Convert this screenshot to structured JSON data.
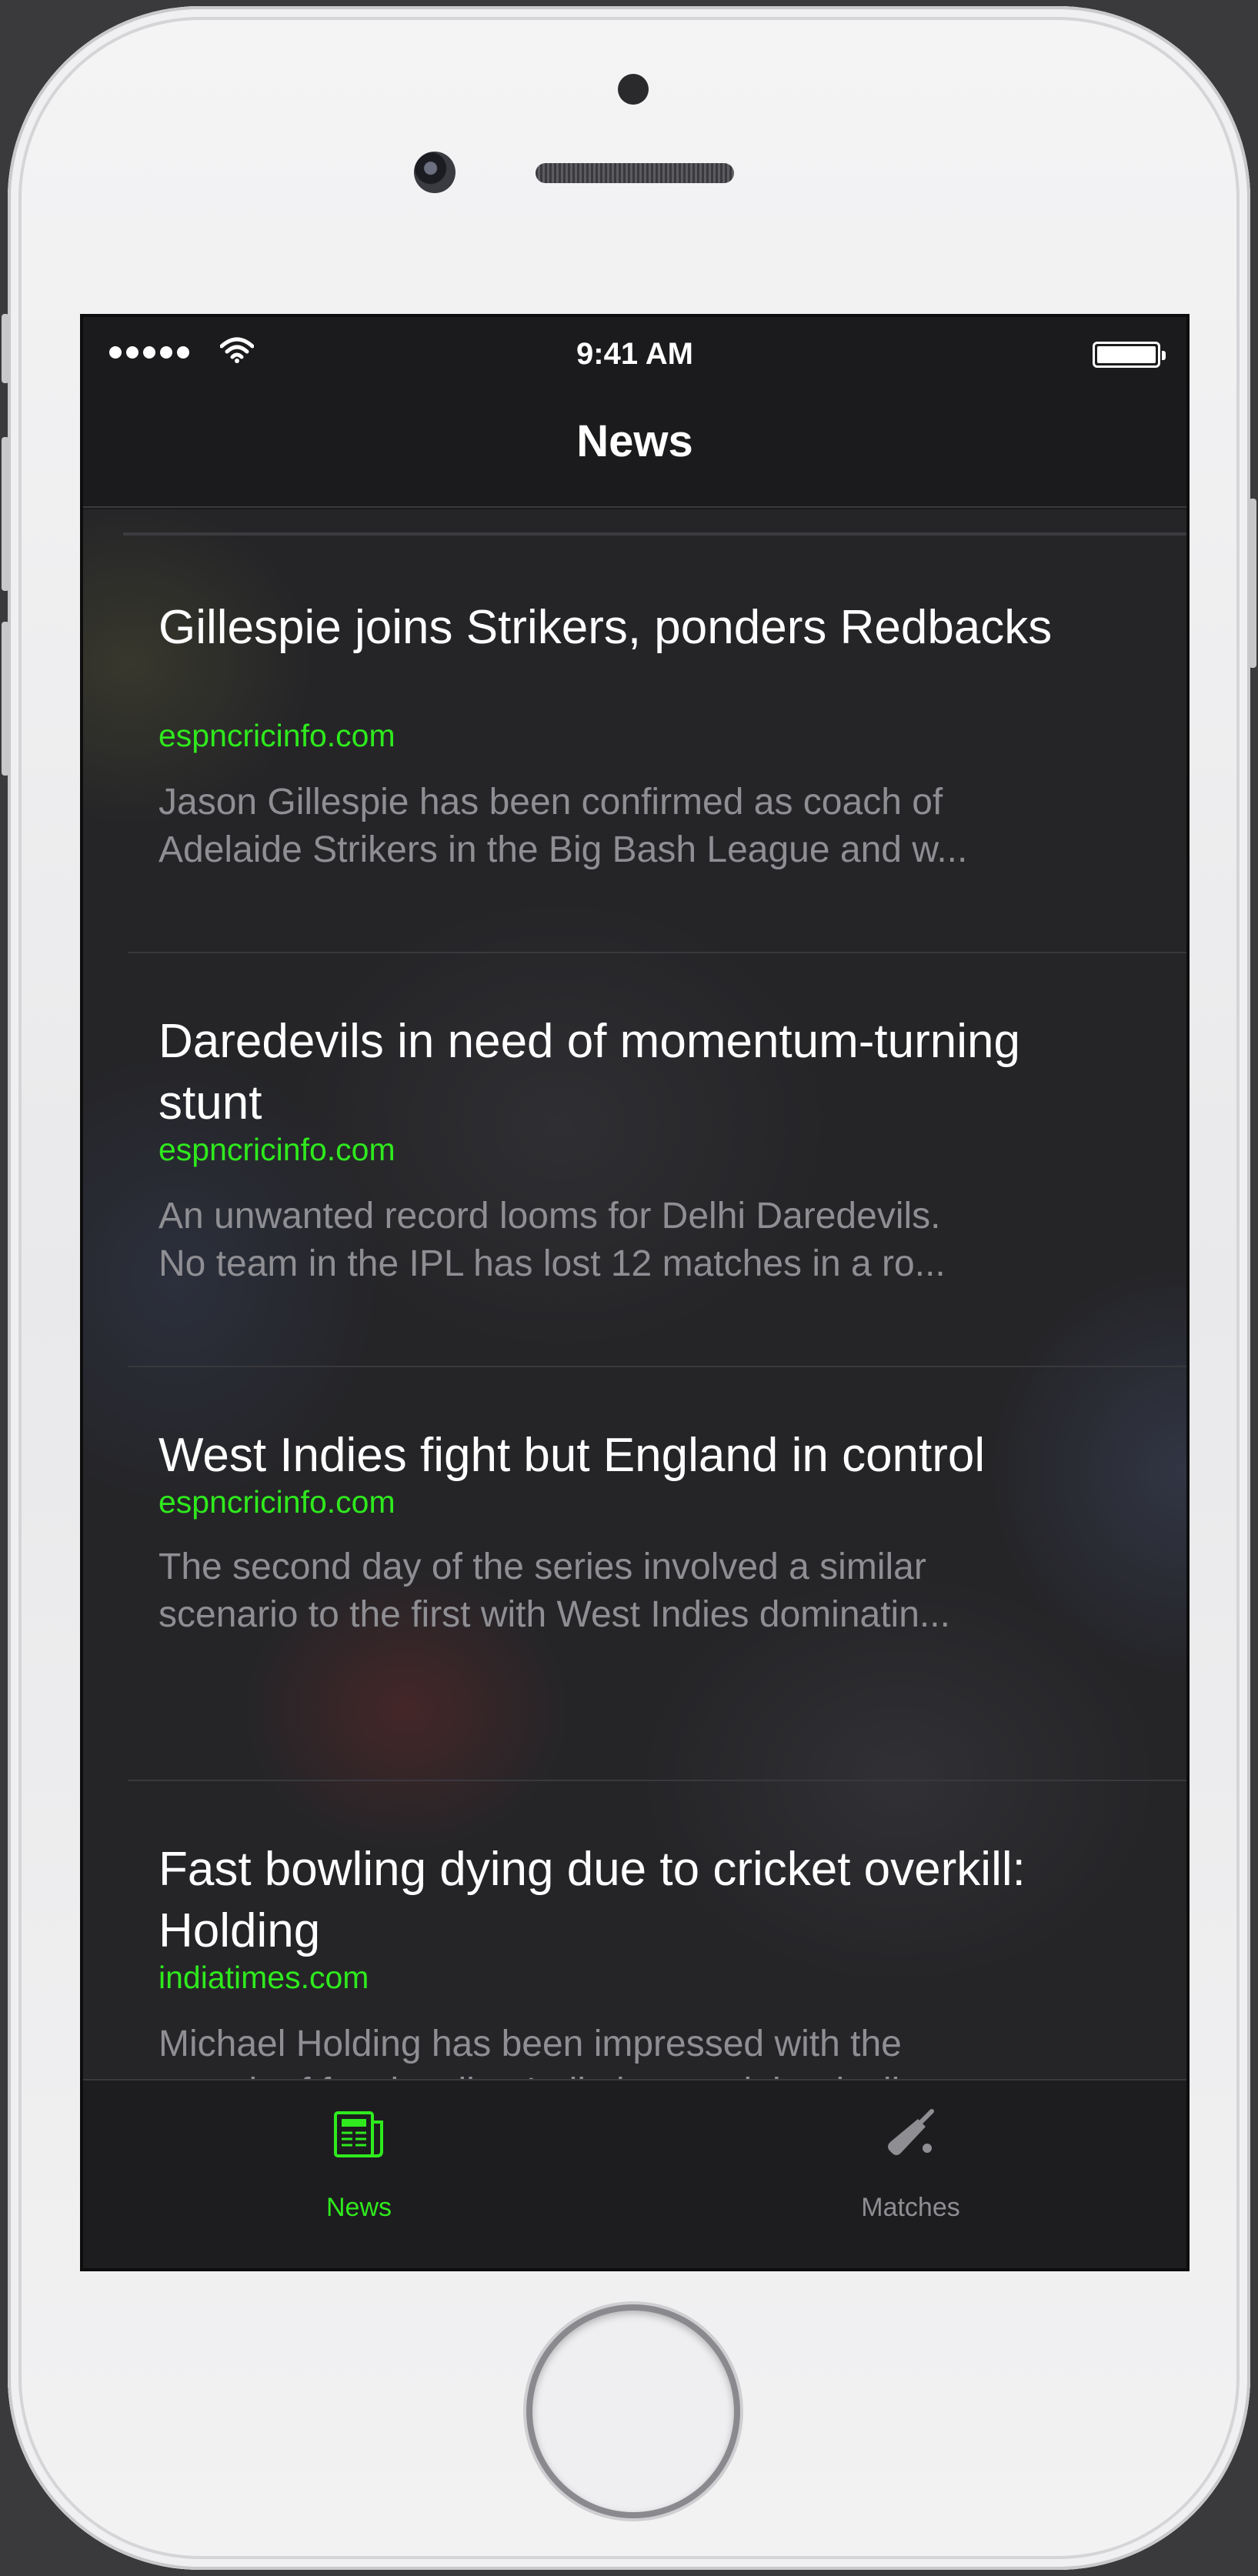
{
  "status_bar": {
    "time": "9:41 AM",
    "signal_icon": "signal-dots-icon",
    "wifi_icon": "wifi-icon",
    "battery_icon": "battery-icon"
  },
  "nav": {
    "title": "News"
  },
  "news": [
    {
      "title": "Gillespie joins Strikers, ponders Redbacks",
      "source": "espncricinfo.com",
      "description_line1": "Jason Gillespie has been confirmed as coach of",
      "description_line2": "Adelaide Strikers in the Big Bash League and w..."
    },
    {
      "title": "Daredevils in need of momentum-turning stunt",
      "source": "espncricinfo.com",
      "description_line1": "An unwanted record looms for Delhi Daredevils.",
      "description_line2": "No team in the IPL has lost 12 matches in a ro..."
    },
    {
      "title": "West Indies fight but England in control",
      "source": "espncricinfo.com",
      "description_line1": "The second day of the series involved a similar",
      "description_line2": "scenario to the first with West Indies dominatin..."
    },
    {
      "title": "Fast bowling dying due to cricket overkill: Holding",
      "source": "indiatimes.com",
      "description_line1": "Michael Holding has been impressed with the",
      "description_line2": "growth of fast bowling India but rued the declin..."
    }
  ],
  "tabs": [
    {
      "label": "News",
      "icon": "newspaper-icon",
      "selected": true
    },
    {
      "label": "Matches",
      "icon": "cricket-bat-icon",
      "selected": false
    }
  ],
  "colors": {
    "accent": "#2fea1d",
    "background": "#252528",
    "text_secondary": "#8e8e93"
  }
}
